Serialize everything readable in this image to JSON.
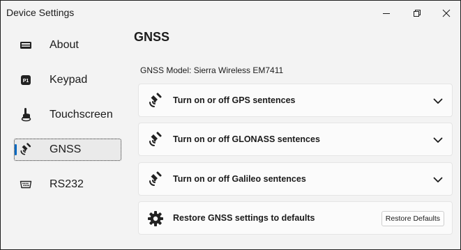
{
  "window": {
    "title": "Device Settings"
  },
  "sidebar": {
    "items": [
      {
        "label": "About",
        "icon": "keyboard-icon"
      },
      {
        "label": "Keypad",
        "icon": "p1-key-icon"
      },
      {
        "label": "Touchscreen",
        "icon": "touch-hand-icon"
      },
      {
        "label": "GNSS",
        "icon": "satellite-icon",
        "selected": true
      },
      {
        "label": "RS232",
        "icon": "serial-port-icon"
      }
    ]
  },
  "main": {
    "title": "GNSS",
    "model_line": "GNSS Model: Sierra Wireless EM7411",
    "cards": [
      {
        "label": "Turn on or off GPS sentences",
        "icon": "satellite-icon"
      },
      {
        "label": "Turn on or off GLONASS sentences",
        "icon": "satellite-icon"
      },
      {
        "label": "Turn on or off Galileo sentences",
        "icon": "satellite-icon"
      }
    ],
    "restore": {
      "label": "Restore GNSS settings to defaults",
      "button_label": "Restore Defaults",
      "icon": "gear-icon"
    }
  },
  "colors": {
    "accent": "#0067c0",
    "window_bg": "#f3f3f3",
    "card_bg": "#fbfbfb"
  }
}
